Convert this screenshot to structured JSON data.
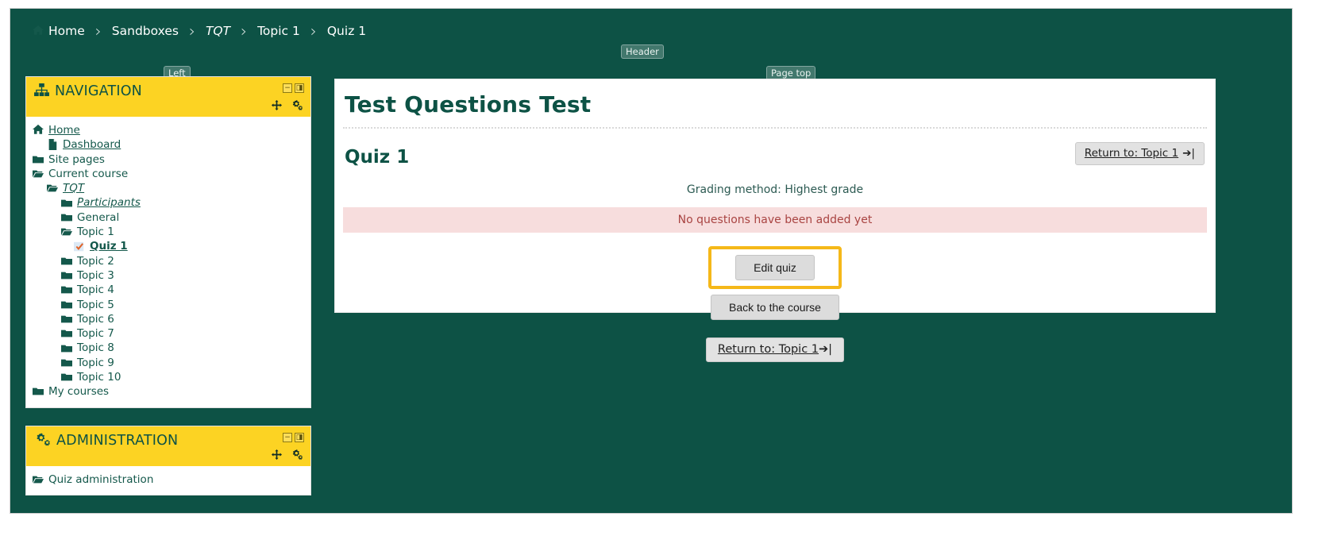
{
  "breadcrumb": {
    "items": [
      {
        "label": "Home",
        "icon": "home-icon",
        "italic": false
      },
      {
        "label": "Sandboxes",
        "icon": "",
        "italic": false
      },
      {
        "label": "TQT",
        "icon": "",
        "italic": true
      },
      {
        "label": "Topic 1",
        "icon": "",
        "italic": false
      },
      {
        "label": "Quiz 1",
        "icon": "",
        "italic": false
      }
    ],
    "separator": "›"
  },
  "region_labels": {
    "header": "Header",
    "left": "Left",
    "page_top": "Page top"
  },
  "blocks": [
    {
      "id": "navigation",
      "title": "NAVIGATION",
      "icon": "sitemap-icon",
      "controls": {
        "collapse": "−",
        "dock": "◨"
      },
      "actions": {
        "move": "move-icon",
        "config": "gear-icon"
      },
      "items": [
        {
          "label": "Home",
          "icon": "home-icon",
          "indent": 0,
          "link": true,
          "italic": false,
          "bold": false
        },
        {
          "label": "Dashboard",
          "icon": "file-icon",
          "indent": 1,
          "link": true,
          "italic": false,
          "bold": false
        },
        {
          "label": "Site pages",
          "icon": "folder-icon",
          "indent": 0,
          "link": false,
          "italic": false,
          "bold": false
        },
        {
          "label": "Current course",
          "icon": "folder-open-icon",
          "indent": 0,
          "link": false,
          "italic": false,
          "bold": false
        },
        {
          "label": "TQT",
          "icon": "folder-open-icon",
          "indent": 1,
          "link": true,
          "italic": true,
          "bold": false
        },
        {
          "label": "Participants",
          "icon": "folder-icon",
          "indent": 2,
          "link": true,
          "italic": true,
          "bold": false
        },
        {
          "label": "General",
          "icon": "folder-icon",
          "indent": 2,
          "link": false,
          "italic": false,
          "bold": false
        },
        {
          "label": "Topic 1",
          "icon": "folder-open-icon",
          "indent": 2,
          "link": false,
          "italic": false,
          "bold": false
        },
        {
          "label": "Quiz 1",
          "icon": "quiz-check-icon",
          "indent": 3,
          "link": true,
          "italic": false,
          "bold": true
        },
        {
          "label": "Topic 2",
          "icon": "folder-icon",
          "indent": 2,
          "link": false,
          "italic": false,
          "bold": false
        },
        {
          "label": "Topic 3",
          "icon": "folder-icon",
          "indent": 2,
          "link": false,
          "italic": false,
          "bold": false
        },
        {
          "label": "Topic 4",
          "icon": "folder-icon",
          "indent": 2,
          "link": false,
          "italic": false,
          "bold": false
        },
        {
          "label": "Topic 5",
          "icon": "folder-icon",
          "indent": 2,
          "link": false,
          "italic": false,
          "bold": false
        },
        {
          "label": "Topic 6",
          "icon": "folder-icon",
          "indent": 2,
          "link": false,
          "italic": false,
          "bold": false
        },
        {
          "label": "Topic 7",
          "icon": "folder-icon",
          "indent": 2,
          "link": false,
          "italic": false,
          "bold": false
        },
        {
          "label": "Topic 8",
          "icon": "folder-icon",
          "indent": 2,
          "link": false,
          "italic": false,
          "bold": false
        },
        {
          "label": "Topic 9",
          "icon": "folder-icon",
          "indent": 2,
          "link": false,
          "italic": false,
          "bold": false
        },
        {
          "label": "Topic 10",
          "icon": "folder-icon",
          "indent": 2,
          "link": false,
          "italic": false,
          "bold": false
        },
        {
          "label": "My courses",
          "icon": "folder-icon",
          "indent": 0,
          "link": false,
          "italic": false,
          "bold": false
        }
      ]
    },
    {
      "id": "administration",
      "title": "ADMINISTRATION",
      "icon": "gears-icon",
      "controls": {
        "collapse": "−",
        "dock": "◨"
      },
      "actions": {
        "move": "move-icon",
        "config": "gear-icon"
      },
      "items": [
        {
          "label": "Quiz administration",
          "icon": "folder-open-icon",
          "indent": 0,
          "link": false,
          "italic": false,
          "bold": false
        }
      ]
    }
  ],
  "main": {
    "site_title": "Test Questions Test",
    "quiz_title": "Quiz 1",
    "return_button": {
      "label": "Return to: Topic 1",
      "icon": "sign-in-icon"
    },
    "grading_method": "Grading method: Highest grade",
    "alert": "No questions have been added yet",
    "edit_quiz_button": "Edit quiz",
    "back_course_button": "Back to the course",
    "bottom_return_button": {
      "label": "Return to: Topic 1",
      "icon": "sign-in-icon"
    }
  },
  "colors": {
    "page_bg": "#0d5245",
    "block_header": "#fcd323",
    "heading": "#0d5245",
    "alert_bg": "#f7dddd",
    "alert_text": "#a94442",
    "highlight": "#f5b819"
  }
}
